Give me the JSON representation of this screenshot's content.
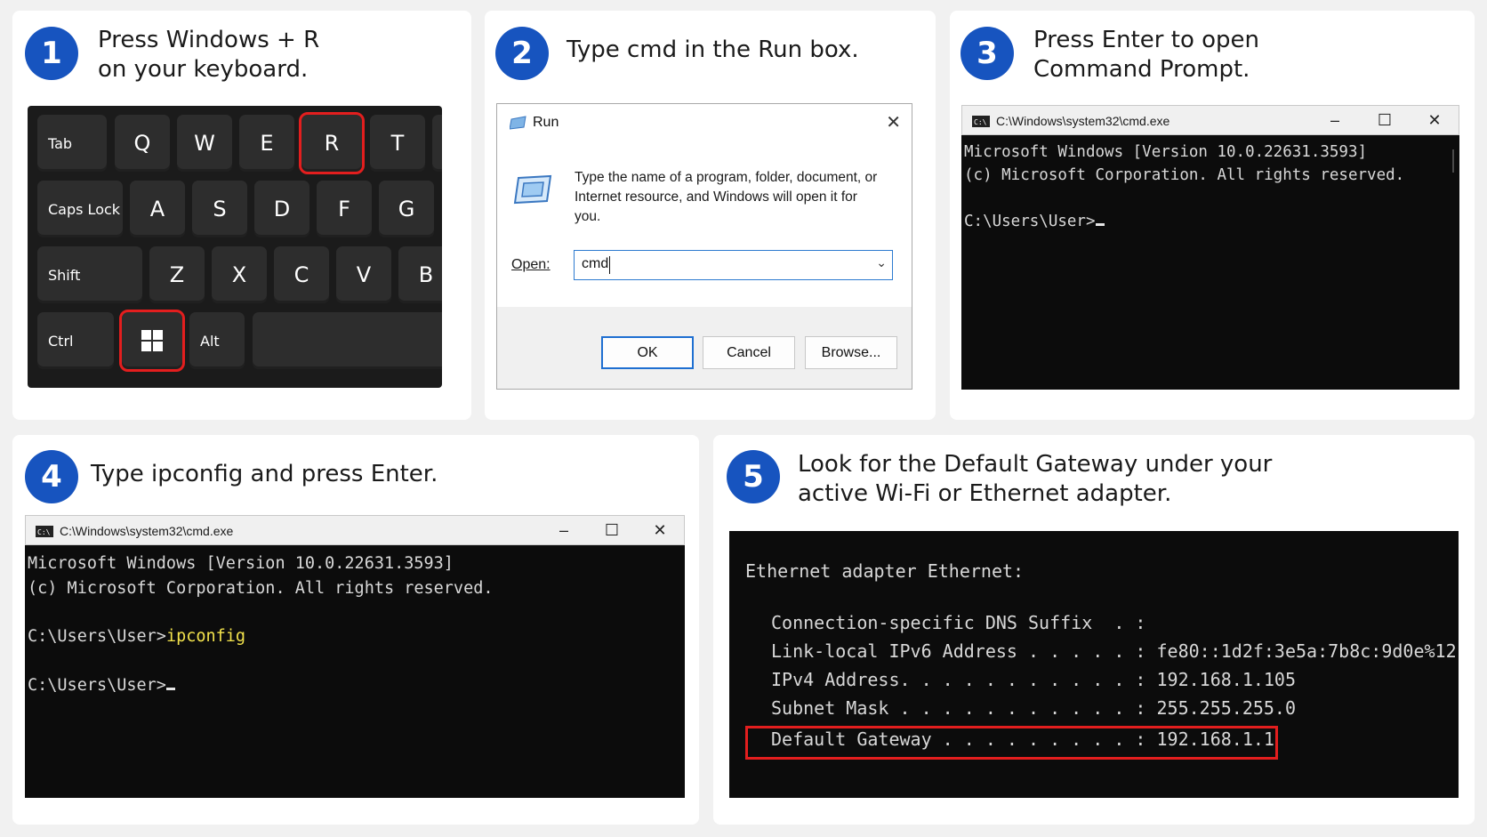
{
  "steps": [
    {
      "num": "1",
      "line1": "Press Windows + R",
      "line2": "on your keyboard."
    },
    {
      "num": "2",
      "line1": "Type cmd in the Run box."
    },
    {
      "num": "3",
      "line1": "Press Enter to open",
      "line2": "Command Prompt."
    },
    {
      "num": "4",
      "line1": "Type ipconfig and press Enter."
    },
    {
      "num": "5",
      "line1": "Look for the Default Gateway under your",
      "line2": "active Wi-Fi or Ethernet adapter."
    }
  ],
  "keyboard": {
    "row1": [
      "Tab",
      "Q",
      "W",
      "E",
      "R",
      "T"
    ],
    "row2": [
      "Caps Lock",
      "A",
      "S",
      "D",
      "F",
      "G"
    ],
    "row3": [
      "Shift",
      "Z",
      "X",
      "C",
      "V",
      "B"
    ],
    "row4": [
      "Ctrl",
      "Alt"
    ],
    "highlighted": [
      "R",
      "Windows"
    ],
    "highlight_color": "#e31e1e"
  },
  "run_dialog": {
    "title": "Run",
    "description": "Type the name of a program, folder, document, or Internet resource, and Windows will open it for you.",
    "open_label": "Open:",
    "input_value": "cmd",
    "ok": "OK",
    "cancel": "Cancel",
    "browse": "Browse..."
  },
  "terminal": {
    "title": "C:\\Windows\\system32\\cmd.exe",
    "line1": "Microsoft Windows [Version 10.0.22631.3593]",
    "line2": "(c) Microsoft Corporation. All rights reserved.",
    "prompt": "C:\\Users\\User>",
    "command": "ipconfig",
    "command_color": "#f2e24c"
  },
  "ipconfig": {
    "header": "Ethernet adapter Ethernet:",
    "rows": [
      {
        "label": "Connection-specific DNS Suffix  . :",
        "value": ""
      },
      {
        "label": "Link-local IPv6 Address . . . . . :",
        "value": "fe80::1d2f:3e5a:7b8c:9d0e%12"
      },
      {
        "label": "IPv4 Address. . . . . . . . . . . :",
        "value": "192.168.1.105"
      },
      {
        "label": "Subnet Mask . . . . . . . . . . . :",
        "value": "255.255.255.0"
      },
      {
        "label": "Default Gateway . . . . . . . . . :",
        "value": "192.168.1.1"
      }
    ],
    "highlight_color": "#e31e1e"
  },
  "colors": {
    "badge": "#1754bf",
    "background": "#f1f1f1",
    "card": "#ffffff",
    "terminal_bg": "#0c0c0c"
  }
}
